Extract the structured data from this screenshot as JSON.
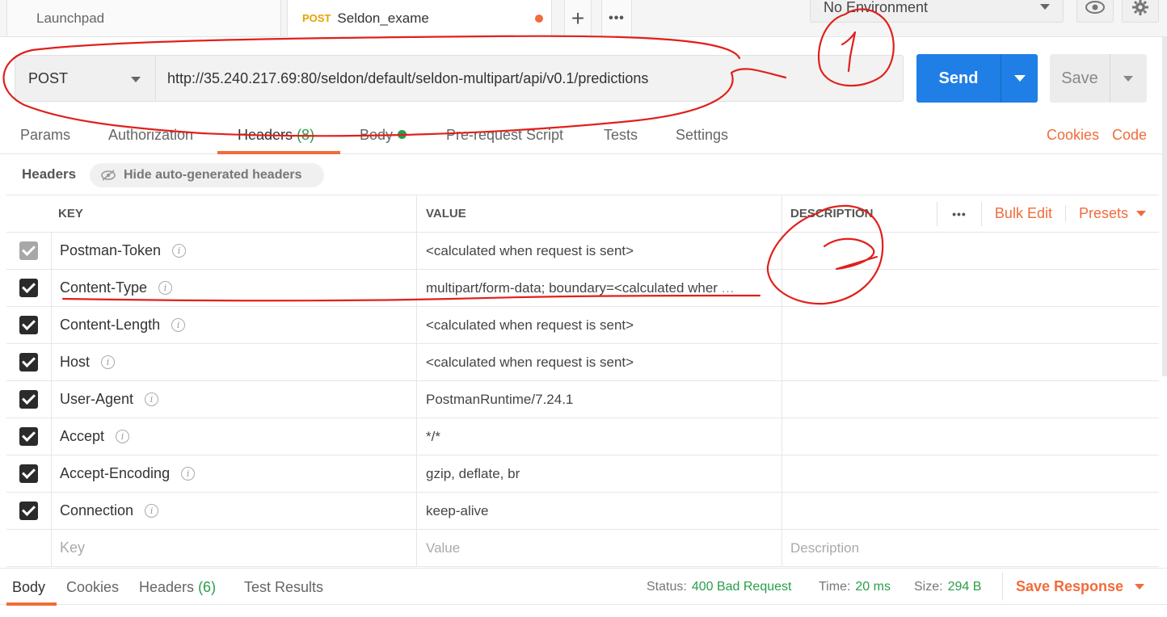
{
  "tabs": {
    "launchpad": "Launchpad",
    "active_method": "POST",
    "active_title": "Seldon_exame",
    "plus": "+",
    "more": "•••"
  },
  "environment": {
    "selected": "No Environment"
  },
  "request": {
    "method": "POST",
    "url": "http://35.240.217.69:80/seldon/default/seldon-multipart/api/v0.1/predictions",
    "send_label": "Send",
    "save_label": "Save"
  },
  "request_tabs": {
    "params": "Params",
    "authorization": "Authorization",
    "headers": "Headers",
    "headers_count": "(8)",
    "body": "Body",
    "prerequest": "Pre-request Script",
    "tests": "Tests",
    "settings": "Settings",
    "cookies": "Cookies",
    "code": "Code"
  },
  "headers_section": {
    "title": "Headers",
    "hide_auto": "Hide auto-generated headers"
  },
  "table": {
    "columns": {
      "key": "KEY",
      "value": "VALUE",
      "description": "DESCRIPTION"
    },
    "tools": {
      "more": "•••",
      "bulk_edit": "Bulk Edit",
      "presets": "Presets"
    },
    "rows": [
      {
        "key": "Postman-Token",
        "value": "<calculated when request is sent>",
        "disabled": true
      },
      {
        "key": "Content-Type",
        "value": "multipart/form-data; boundary=<calculated wher",
        "truncated": true
      },
      {
        "key": "Content-Length",
        "value": "<calculated when request is sent>"
      },
      {
        "key": "Host",
        "value": "<calculated when request is sent>"
      },
      {
        "key": "User-Agent",
        "value": "PostmanRuntime/7.24.1"
      },
      {
        "key": "Accept",
        "value": "*/*"
      },
      {
        "key": "Accept-Encoding",
        "value": "gzip, deflate, br"
      },
      {
        "key": "Connection",
        "value": "keep-alive"
      }
    ],
    "new_row": {
      "key": "Key",
      "value": "Value",
      "description": "Description"
    }
  },
  "response": {
    "tabs": {
      "body": "Body",
      "cookies": "Cookies",
      "headers": "Headers",
      "headers_count": "(6)",
      "test_results": "Test Results"
    },
    "status_label": "Status:",
    "status_value": "400 Bad Request",
    "time_label": "Time:",
    "time_value": "20 ms",
    "size_label": "Size:",
    "size_value": "294 B",
    "save_response": "Save Response"
  },
  "colors": {
    "accent": "#f26b3a",
    "send_blue": "#1f7fe6",
    "success_green": "#2a9d4a",
    "annotation_red": "#e0201b"
  }
}
